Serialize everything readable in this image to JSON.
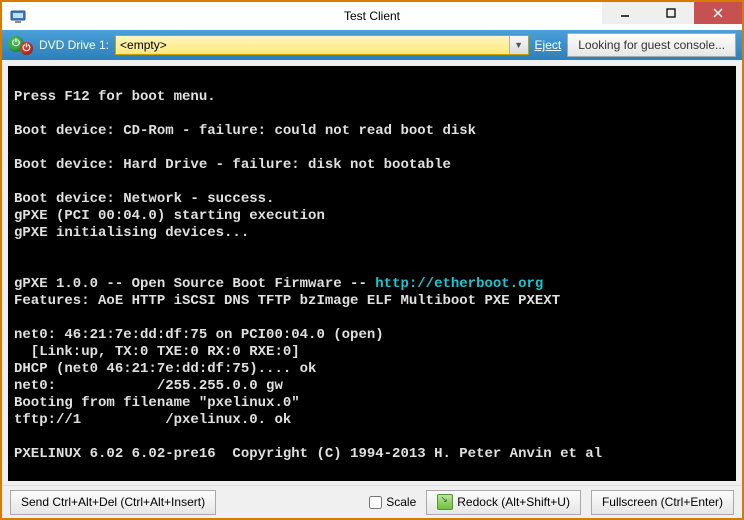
{
  "window": {
    "title": "Test Client"
  },
  "toolbar": {
    "dvd_label": "DVD Drive 1:",
    "drive_value": "<empty>",
    "eject": "Eject",
    "guest_console": "Looking for guest console..."
  },
  "console": {
    "pre1": "\nPress F12 for boot menu.\n\nBoot device: CD-Rom - failure: could not read boot disk\n\nBoot device: Hard Drive - failure: disk not bootable\n\nBoot device: Network - success.\ngPXE (PCI 00:04.0) starting execution\ngPXE initialising devices...\n\n\ngPXE 1.0.0 -- Open Source Boot Firmware -- ",
    "link": "http://etherboot.org",
    "post1": "\nFeatures: AoE HTTP iSCSI DNS TFTP bzImage ELF Multiboot PXE PXEXT\n\nnet0: 46:21:7e:dd:df:75 on PCI00:04.0 (open)\n  [Link:up, TX:0 TXE:0 RX:0 RXE:0]\nDHCP (net0 46:21:7e:dd:df:75).... ok\nnet0:            /255.255.0.0 gw\nBooting from filename \"pxelinux.0\"\ntftp://1          /pxelinux.0. ok\n\nPXELINUX 6.02 6.02-pre16  Copyright (C) 1994-2013 H. Peter Anvin et al"
  },
  "bottom": {
    "send_cad": "Send Ctrl+Alt+Del (Ctrl+Alt+Insert)",
    "scale": "Scale",
    "redock": "Redock (Alt+Shift+U)",
    "fullscreen": "Fullscreen (Ctrl+Enter)"
  }
}
